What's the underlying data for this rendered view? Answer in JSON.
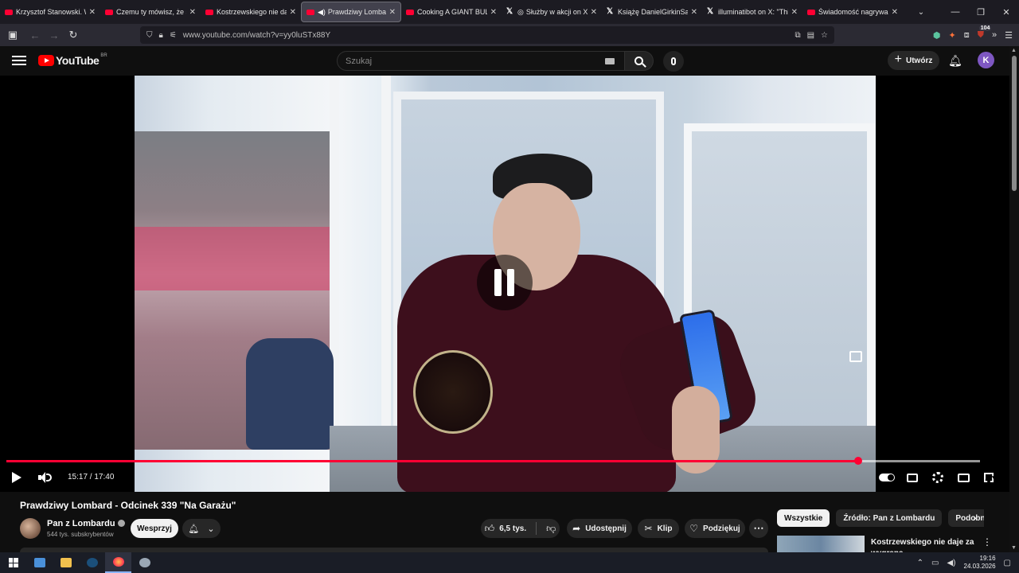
{
  "browser": {
    "tabs": [
      {
        "title": "Krzysztof Stanowski. W ja",
        "icon": "youtube-icon",
        "active": false
      },
      {
        "title": "Czemu ty mówisz, że się",
        "icon": "youtube-icon",
        "active": false
      },
      {
        "title": "Kostrzewskiego nie daje",
        "icon": "youtube-icon",
        "active": false
      },
      {
        "title": "Prawdziwy Lombard",
        "icon": "youtube-icon",
        "active": true
      },
      {
        "title": "Cooking A GIANT BULL F",
        "icon": "youtube-icon",
        "active": false
      },
      {
        "title": "Służby w akcji on X: ",
        "icon": "x-icon",
        "active": false
      },
      {
        "title": "Książę DanielGirkinSalaz",
        "icon": "x-icon",
        "active": false
      },
      {
        "title": "illuminatibot on X: \"This",
        "icon": "x-icon",
        "active": false
      },
      {
        "title": "Świadomość nagrywania",
        "icon": "youtube-icon",
        "active": false
      }
    ],
    "url": "www.youtube.com/watch?v=yy0luSTx88Y",
    "extensions_badge": "104"
  },
  "youtube": {
    "logo_text": "YouTube",
    "logo_country": "BR",
    "search_placeholder": "Szukaj",
    "create_label": "Utwórz",
    "avatar_letter": "K"
  },
  "player": {
    "time_display": "15:17 / 17:40",
    "progress_fraction": 0.8747,
    "buffer_fraction": 1.0
  },
  "video": {
    "title": "Prawdziwy Lombard - Odcinek 339 \"Na Garażu\"",
    "channel_name": "Pan z Lombardu",
    "subscribers": "544 tys. subskrybentów",
    "support_label": "Wesprzyj",
    "likes": "6,5 tys.",
    "share_label": "Udostępnij",
    "clip_label": "Klip",
    "thanks_label": "Podziękuj"
  },
  "sidebar": {
    "chips": [
      {
        "label": "Wszystkie",
        "selected": true
      },
      {
        "label": "Źródło: Pan z Lombardu",
        "selected": false
      },
      {
        "label": "Podobne",
        "selected": false
      }
    ],
    "related": [
      {
        "title": "Kostrzewskiego nie daje za wygraną"
      }
    ]
  },
  "taskbar": {
    "time": "19:16",
    "date": "24.03.2026"
  },
  "colors": {
    "accent_red": "#ff0033",
    "youtube_red": "#ff0000",
    "avatar_bg": "#7e57c2",
    "background": "#0f0f0f"
  }
}
